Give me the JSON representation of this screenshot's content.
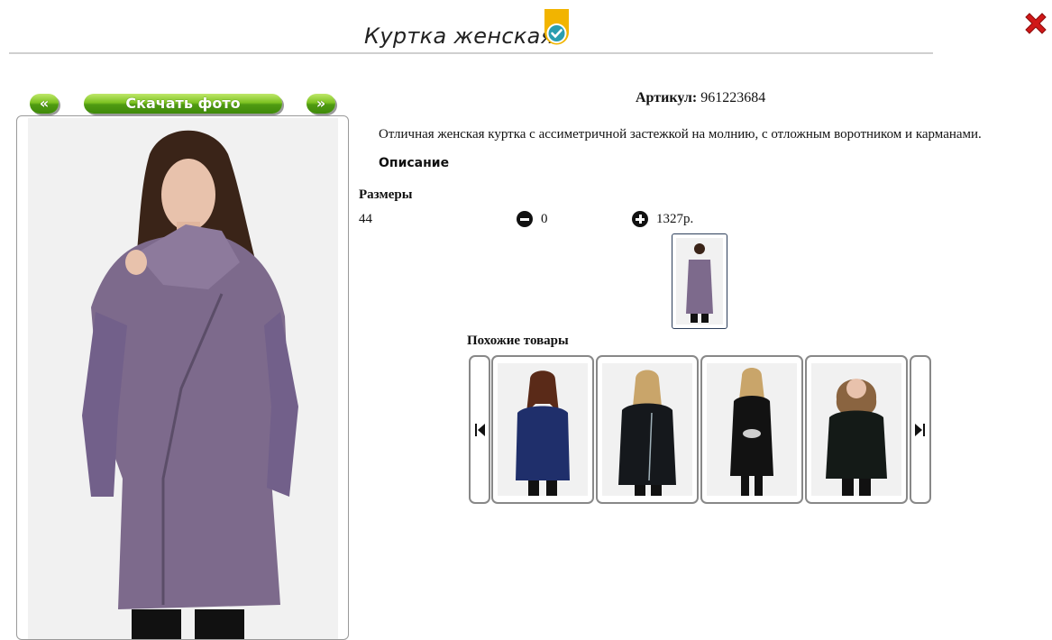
{
  "header": {
    "title": "Куртка женская"
  },
  "gallery": {
    "prev_label": "«",
    "download_label": "Скачать фото",
    "next_label": "»"
  },
  "product": {
    "article_label": "Артикул:",
    "article_value": "961223684",
    "description_text": "Отличная женская куртка с ассиметричной застежкой на молнию, с отложным воротником и карманами.",
    "description_label": "Описание",
    "sizes_label": "Размеры",
    "sizes": [
      {
        "size": "44",
        "quantity": "0",
        "price": "1327р."
      }
    ]
  },
  "similar": {
    "label": "Похожие товары",
    "items": [
      {
        "coat_color": "#1f2f6b"
      },
      {
        "coat_color": "#15181c"
      },
      {
        "coat_color": "#121212"
      },
      {
        "coat_color": "#141a17"
      }
    ]
  },
  "colors": {
    "accent_green": "#5aa817",
    "close_red": "#d01818",
    "main_coat": "#7d6a8c"
  },
  "icons": [
    "verified-badge-icon",
    "close-icon",
    "minus-circle-icon",
    "plus-circle-icon",
    "skip-back-icon",
    "skip-forward-icon"
  ]
}
